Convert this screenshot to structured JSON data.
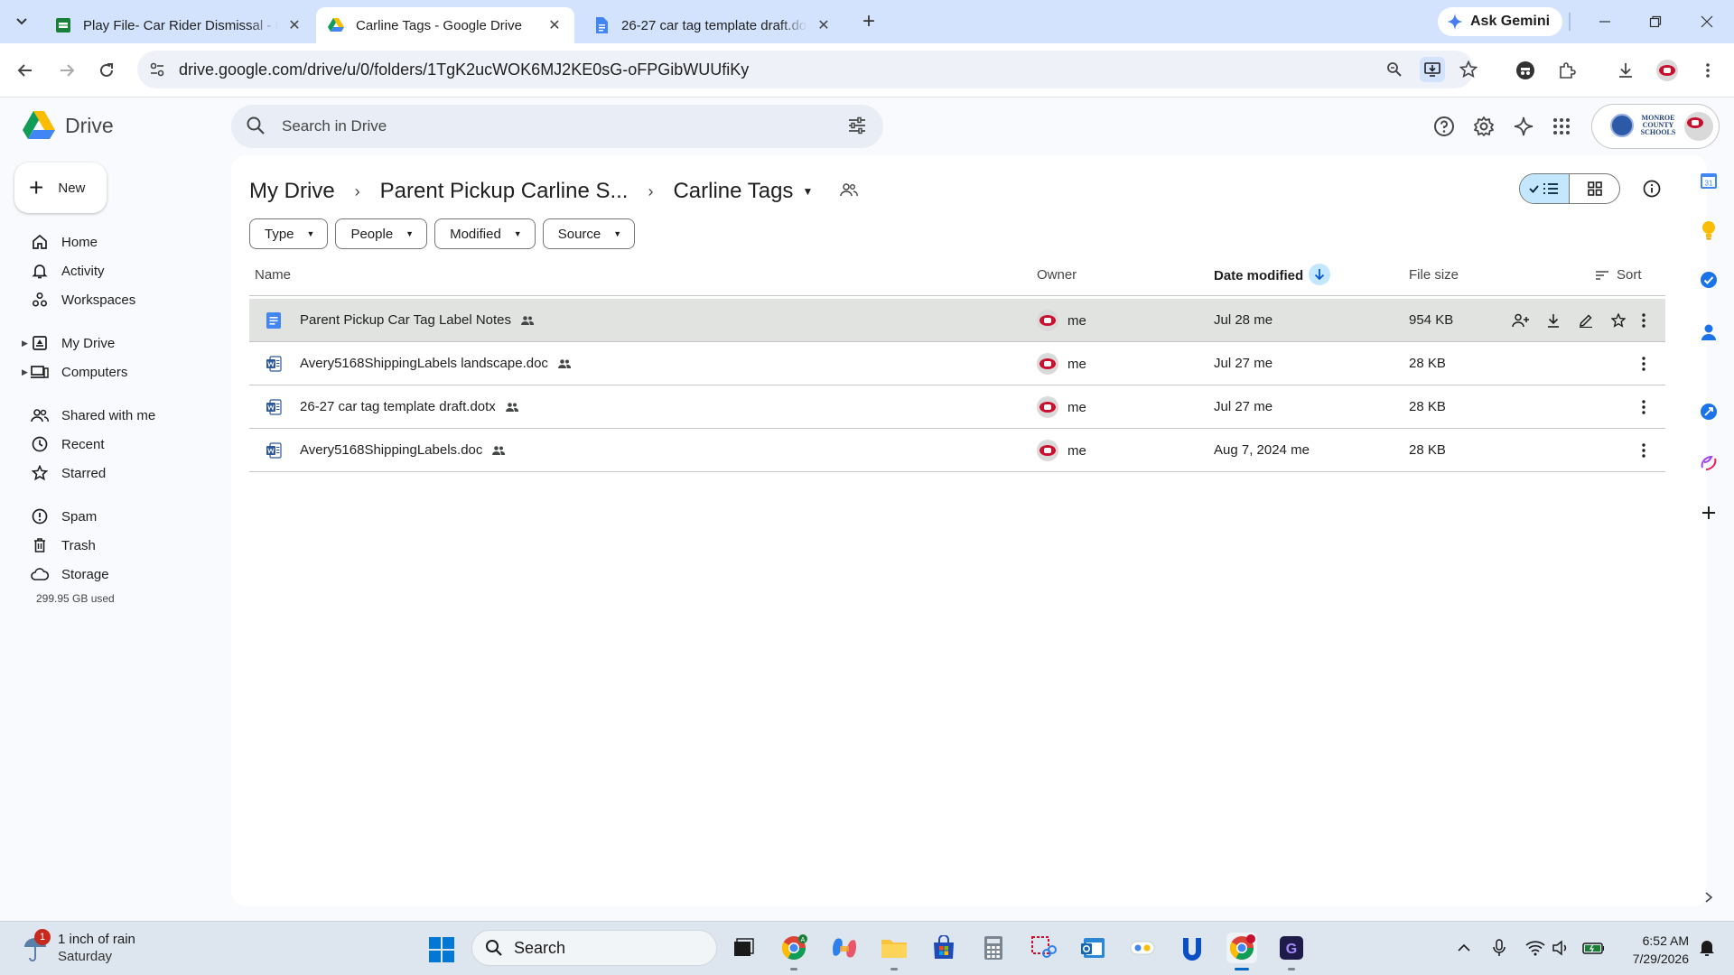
{
  "browser": {
    "tabs": [
      {
        "title": "Play File- Car Rider Dismissal - F",
        "active": false,
        "icon": "google-sheets-icon"
      },
      {
        "title": "Carline Tags - Google Drive",
        "active": true,
        "icon": "google-drive-icon"
      },
      {
        "title": "26-27 car tag template draft.do",
        "active": false,
        "icon": "google-docs-icon"
      }
    ],
    "gemini_label": "Ask Gemini",
    "url": "drive.google.com/drive/u/0/folders/1TgK2ucWOK6MJ2KE0sG-oFPGibWUUfiKy"
  },
  "drive": {
    "app_name": "Drive",
    "search_placeholder": "Search in Drive",
    "account_org": [
      "MONROE",
      "COUNTY",
      "SCHOOLS"
    ]
  },
  "sidebar": {
    "new_label": "New",
    "items": [
      {
        "label": "Home",
        "icon": "home-icon"
      },
      {
        "label": "Activity",
        "icon": "bell-icon"
      },
      {
        "label": "Workspaces",
        "icon": "workspaces-icon"
      },
      {
        "label": "My Drive",
        "icon": "my-drive-icon"
      },
      {
        "label": "Computers",
        "icon": "computers-icon"
      },
      {
        "label": "Shared with me",
        "icon": "people-icon"
      },
      {
        "label": "Recent",
        "icon": "clock-icon"
      },
      {
        "label": "Starred",
        "icon": "star-icon"
      },
      {
        "label": "Spam",
        "icon": "spam-icon"
      },
      {
        "label": "Trash",
        "icon": "trash-icon"
      },
      {
        "label": "Storage",
        "icon": "cloud-icon"
      }
    ],
    "storage_used": "299.95 GB used"
  },
  "main": {
    "breadcrumbs": [
      "My Drive",
      "Parent Pickup Carline S...",
      "Carline Tags"
    ],
    "filters": [
      "Type",
      "People",
      "Modified",
      "Source"
    ],
    "columns": {
      "name": "Name",
      "owner": "Owner",
      "date": "Date modified",
      "size": "File size",
      "sort": "Sort"
    },
    "files": [
      {
        "name": "Parent Pickup Car Tag Label Notes",
        "type": "gdoc",
        "owner": "me",
        "date": "Jul 28 me",
        "size": "954 KB",
        "selected": true
      },
      {
        "name": "Avery5168ShippingLabels landscape.doc",
        "type": "word",
        "owner": "me",
        "date": "Jul 27 me",
        "size": "28 KB",
        "selected": false
      },
      {
        "name": "26-27 car tag template draft.dotx",
        "type": "word",
        "owner": "me",
        "date": "Jul 27 me",
        "size": "28 KB",
        "selected": false
      },
      {
        "name": "Avery5168ShippingLabels.doc",
        "type": "word",
        "owner": "me",
        "date": "Aug 7, 2024 me",
        "size": "28 KB",
        "selected": false
      }
    ]
  },
  "taskbar": {
    "weather_title": "1 inch of rain",
    "weather_sub": "Saturday",
    "weather_badge": "1",
    "search_label": "Search",
    "time": "6:52 AM",
    "date": "7/29/2026"
  }
}
